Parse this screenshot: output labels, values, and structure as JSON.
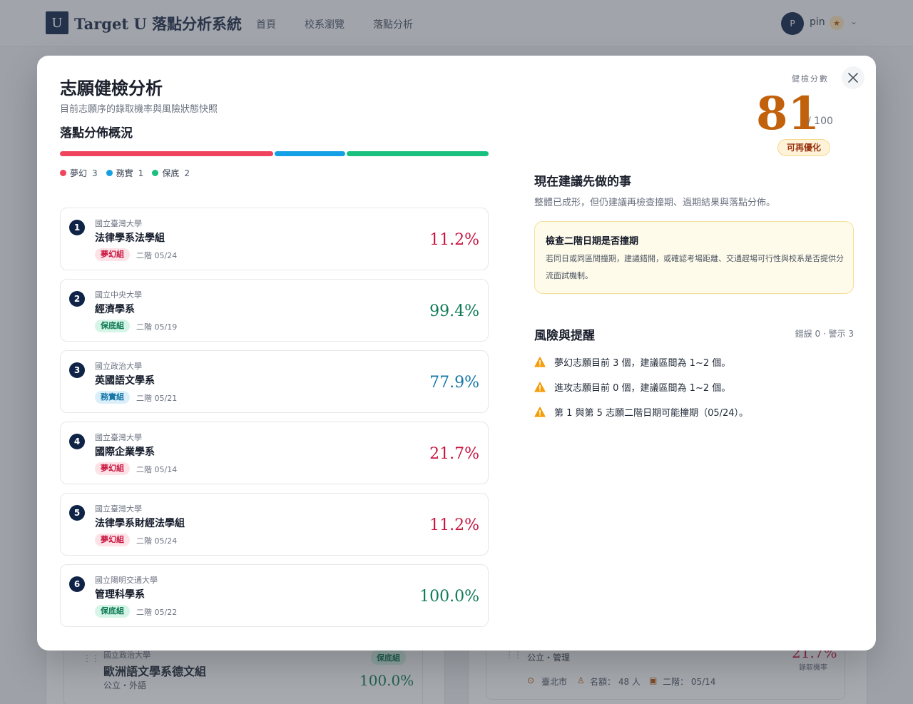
{
  "nav": {
    "logo_letter": "U",
    "brand": "Target U 落點分析系統",
    "links": [
      "首頁",
      "校系瀏覽",
      "落點分析"
    ],
    "user_initial": "P",
    "user_name": "pin"
  },
  "background": {
    "left_card": {
      "school": "國立政治大學",
      "dept": "歐洲語文學系德文組",
      "meta": "公立・外語",
      "tag": "保底組",
      "pct": "100.0%"
    },
    "right_card": {
      "meta": "公立・管理",
      "pct": "21.7%",
      "pct_label": "錄取機率",
      "location": "臺北市",
      "quota": "名額： 48 人",
      "stage2": "二階： 05/14"
    }
  },
  "modal": {
    "title": "志願健檢分析",
    "subtitle": "目前志願序的錄取機率與風險狀態快照",
    "distribution": {
      "title": "落點分佈概況",
      "segments": [
        {
          "name": "夢幻",
          "count": 3,
          "color": "#f0435c"
        },
        {
          "name": "務實",
          "count": 1,
          "color": "#14a0e4"
        },
        {
          "name": "保底",
          "count": 2,
          "color": "#19c07e"
        }
      ]
    },
    "items": [
      {
        "num": "1",
        "school": "國立臺灣大學",
        "dept": "法律學系法學組",
        "tag": "夢幻組",
        "tag_type": "dream",
        "date": "二階 05/24",
        "pct": "11.2%"
      },
      {
        "num": "2",
        "school": "國立中央大學",
        "dept": "經濟學系",
        "tag": "保底組",
        "tag_type": "safe",
        "date": "二階 05/19",
        "pct": "99.4%"
      },
      {
        "num": "3",
        "school": "國立政治大學",
        "dept": "英國語文學系",
        "tag": "務實組",
        "tag_type": "prac",
        "date": "二階 05/21",
        "pct": "77.9%"
      },
      {
        "num": "4",
        "school": "國立臺灣大學",
        "dept": "國際企業學系",
        "tag": "夢幻組",
        "tag_type": "dream",
        "date": "二階 05/14",
        "pct": "21.7%"
      },
      {
        "num": "5",
        "school": "國立臺灣大學",
        "dept": "法律學系財經法學組",
        "tag": "夢幻組",
        "tag_type": "dream",
        "date": "二階 05/24",
        "pct": "11.2%"
      },
      {
        "num": "6",
        "school": "國立陽明交通大學",
        "dept": "管理科學系",
        "tag": "保底組",
        "tag_type": "safe",
        "date": "二階 05/22",
        "pct": "100.0%"
      }
    ],
    "score": {
      "label": "健檢分數",
      "value": "81",
      "max": "/ 100",
      "badge": "可再優化"
    },
    "actions": {
      "title": "現在建議先做的事",
      "subtitle": "整體已成形，但仍建議再檢查撞期、過期結果與落點分佈。",
      "tip_title": "檢查二階日期是否撞期",
      "tip_body": "若同日或同區間撞期，建議錯開，或確認考場距離、交通趕場可行性與校系是否提供分流面試機制。"
    },
    "risks": {
      "title": "風險與提醒",
      "count": "錯誤 0 · 警示 3",
      "items": [
        "夢幻志願目前 3 個，建議區間為 1~2 個。",
        "進攻志願目前 0 個，建議區間為 1~2 個。",
        "第 1 與第 5 志願二階日期可能撞期（05/24）。"
      ]
    }
  },
  "colors": {
    "navy": "#0f2347",
    "dream": "#c8153f",
    "safe": "#0e7a55",
    "prac": "#1677a8",
    "score": "#c2610c",
    "warn": "#f59e0b"
  }
}
